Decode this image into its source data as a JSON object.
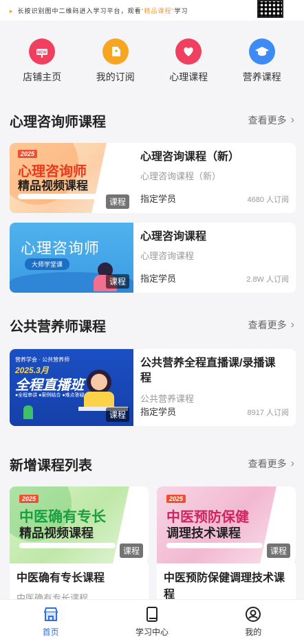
{
  "banner": {
    "text_prefix": "长按识别图中二维码进入学习平台，观看",
    "text_highlight": "“精品课程”",
    "text_suffix": "学习"
  },
  "top_nav": [
    {
      "label": "店铺主页",
      "icon": "shop-icon",
      "color": "#f0405f"
    },
    {
      "label": "我的订阅",
      "icon": "tag-icon",
      "color": "#f6a623"
    },
    {
      "label": "心理课程",
      "icon": "heart-icon",
      "color": "#f0405f"
    },
    {
      "label": "营养课程",
      "icon": "graduation-cap-icon",
      "color": "#3d8bf5"
    }
  ],
  "sections": [
    {
      "title": "心理咨询师课程",
      "more": "查看更多",
      "courses": [
        {
          "title": "心理咨询课程（新）",
          "subtitle": "心理咨询课程（新）",
          "member": "指定学员",
          "count": "4680 人订阅",
          "tag": "课程",
          "thumb_year": "2025",
          "thumb_line1": "心理咨询师",
          "thumb_line2": "精品视频课程"
        },
        {
          "title": "心理咨询课程",
          "subtitle": "心理咨询课程",
          "member": "指定学员",
          "count": "2.8W 人订阅",
          "tag": "课程",
          "thumb_line1": "心理咨询师",
          "thumb_line2": "大师学堂课"
        }
      ]
    },
    {
      "title": "公共营养师课程",
      "more": "查看更多",
      "courses": [
        {
          "title": "公共营养全程直播课/录播课程",
          "subtitle": "公共营养课程",
          "member": "指定学员",
          "count": "8917 人订阅",
          "tag": "课程",
          "thumb_line0": "营养学会 · 公共营养师",
          "thumb_line1": "2025.3月",
          "thumb_line2": "全程直播班",
          "thumb_line3": "●全程串讲  ●案例结合  ●难点答疑"
        }
      ]
    },
    {
      "title": "新增课程列表",
      "more": "查看更多",
      "courses": [
        {
          "title": "中医确有专长课程",
          "subtitle": "中医确有专长课程",
          "tag": "课程",
          "thumb_year": "2025",
          "thumb_line1": "中医确有专长",
          "thumb_line2": "精品视频课程"
        },
        {
          "title": "中医预防保健调理技术课程",
          "subtitle": "",
          "tag": "课程",
          "thumb_year": "2025",
          "thumb_line1": "中医预防保健",
          "thumb_line2": "调理技术课程"
        }
      ]
    }
  ],
  "tabbar": [
    {
      "label": "首页",
      "icon": "home-icon",
      "active": true
    },
    {
      "label": "学习中心",
      "icon": "book-icon",
      "active": false
    },
    {
      "label": "我的",
      "icon": "user-icon",
      "active": false
    }
  ],
  "colors": {
    "accent": "#2f6de1",
    "highlight": "#f29b2e"
  }
}
